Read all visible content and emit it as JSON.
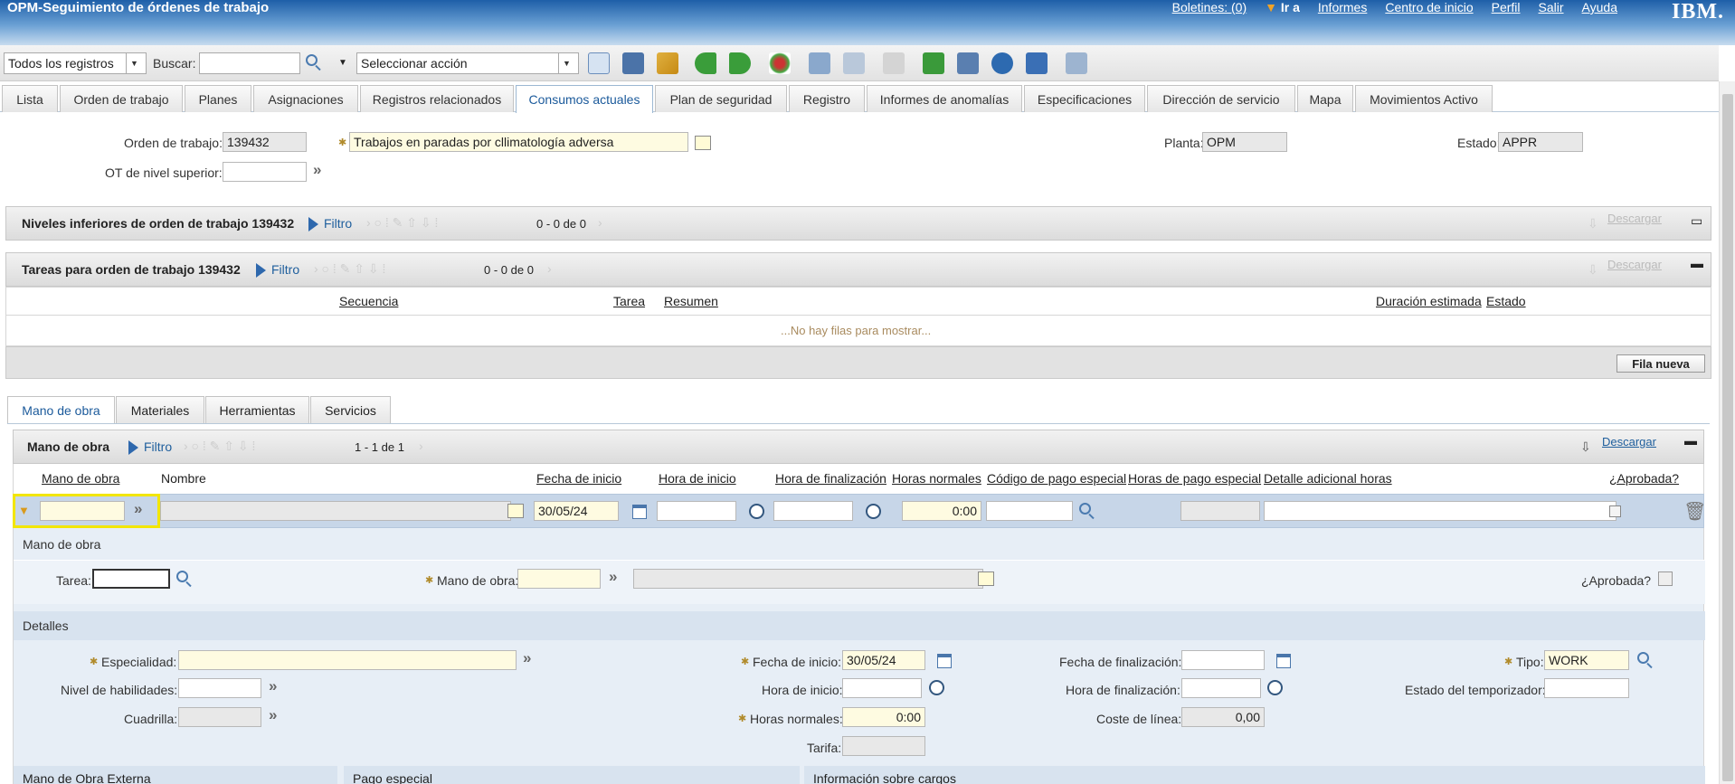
{
  "header": {
    "app_title": "OPM-Seguimiento de órdenes de trabajo",
    "links": [
      "Boletines: (0)",
      "Ir a",
      "Informes",
      "Centro de inicio",
      "Perfil",
      "Salir",
      "Ayuda"
    ],
    "brand": "IBM."
  },
  "toolbar": {
    "query_select": "Todos los registros",
    "search_label": "Buscar:",
    "search_value": "",
    "action_select": "Seleccionar acción"
  },
  "tabs": [
    "Lista",
    "Orden de trabajo",
    "Planes",
    "Asignaciones",
    "Registros relacionados",
    "Consumos actuales",
    "Plan de seguridad",
    "Registro",
    "Informes de anomalías",
    "Especificaciones",
    "Dirección de servicio",
    "Mapa",
    "Movimientos Activo"
  ],
  "wo": {
    "orden_label": "Orden de trabajo:",
    "orden_value": "139432",
    "desc_value": "Trabajos en paradas por cllimatología adversa",
    "ot_sup_label": "OT de nivel superior:",
    "ot_sup_value": "",
    "planta_label": "Planta:",
    "planta_value": "OPM",
    "estado_label": "Estado:",
    "estado_value": "APPR"
  },
  "niveles": {
    "title": "Niveles inferiores de orden de trabajo 139432",
    "filter": "Filtro",
    "count": "0 - 0 de 0",
    "download": "Descargar"
  },
  "tareas": {
    "title": "Tareas para orden de trabajo 139432",
    "filter": "Filtro",
    "count": "0 - 0 de 0",
    "download": "Descargar",
    "columns": [
      "Secuencia",
      "Tarea",
      "Resumen",
      "Duración estimada",
      "Estado"
    ],
    "empty": "...No hay filas para mostrar...",
    "new_row": "Fila nueva"
  },
  "subtabs": [
    "Mano de obra",
    "Materiales",
    "Herramientas",
    "Servicios"
  ],
  "labor": {
    "title": "Mano de obra",
    "filter": "Filtro",
    "count": "1 - 1 de 1",
    "download": "Descargar",
    "columns": [
      "Mano de obra",
      "Nombre",
      "Fecha de inicio",
      "Hora de inicio",
      "Hora de finalización",
      "Horas normales",
      "Código de pago especial",
      "Horas de pago especial",
      "Detalle adicional horas",
      "¿Aprobada?"
    ],
    "row": {
      "mano": "",
      "nombre": "",
      "fecha": "30/05/24",
      "hora_ini": "",
      "hora_fin": "",
      "horas": "0:00",
      "codigo": "",
      "horas_pago": "",
      "detalle": ""
    }
  },
  "detail": {
    "section_title": "Mano de obra",
    "tarea_label": "Tarea:",
    "mano_label": "Mano de obra:",
    "aprobada_label": "¿Aprobada?",
    "detalles_title": "Detalles",
    "especialidad_label": "Especialidad:",
    "fecha_ini_label": "Fecha de inicio:",
    "fecha_ini_value": "30/05/24",
    "fecha_fin_label": "Fecha de finalización:",
    "tipo_label": "Tipo:",
    "tipo_value": "WORK",
    "nivel_label": "Nivel de habilidades:",
    "hora_ini_label": "Hora de inicio:",
    "hora_fin_label": "Hora de finalización:",
    "temporizador_label": "Estado del temporizador:",
    "cuadrilla_label": "Cuadrilla:",
    "horas_label": "Horas normales:",
    "horas_value": "0:00",
    "coste_label": "Coste de línea:",
    "coste_value": "0,00",
    "tarifa_label": "Tarifa:",
    "bottom_titles": [
      "Mano de Obra Externa",
      "Pago especial",
      "Información sobre cargos"
    ]
  },
  "colors": {
    "highlight": "#f2e600",
    "accent": "#1f5f9d"
  }
}
